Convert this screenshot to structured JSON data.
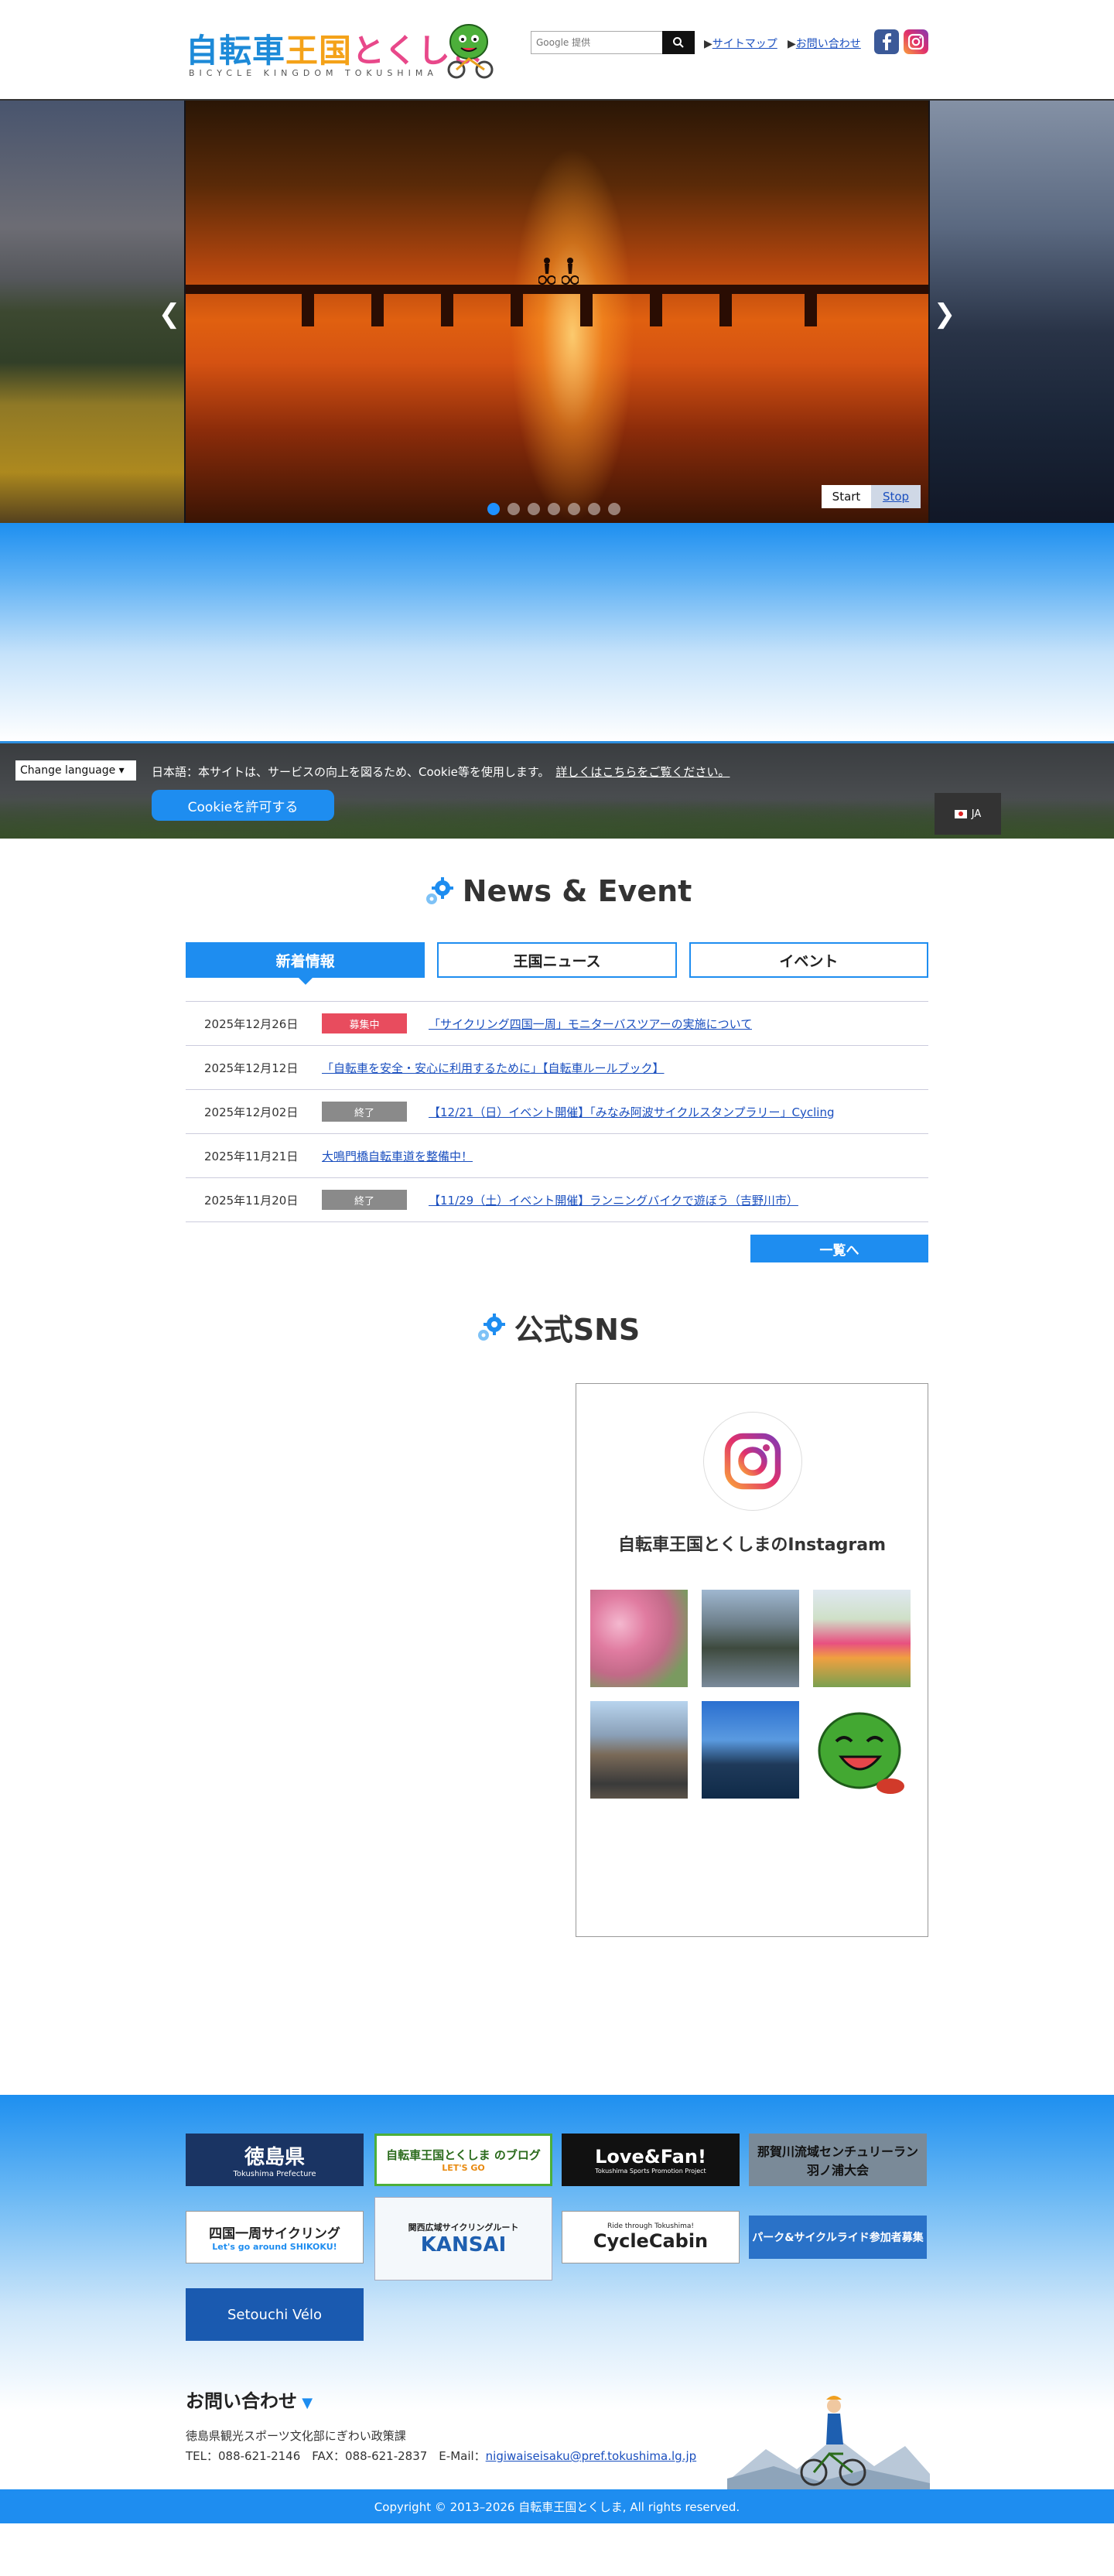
{
  "header": {
    "logo_title_1": "自転車",
    "logo_title_2": "王国",
    "logo_title_3": "とくしま",
    "logo_sub": "BICYCLE KINGDOM TOKUSHIMA",
    "search_placeholder": "Google 提供",
    "sitemap_label": "サイトマップ",
    "contact_label": "お問い合わせ"
  },
  "slider": {
    "start_label": "Start",
    "stop_label": "Stop",
    "dots": [
      1,
      2,
      3,
      4,
      5,
      6,
      7
    ],
    "active_dot": 1
  },
  "cookie": {
    "language_label": "Change language ▾",
    "message": "日本語：本サイトは、サービスの向上を図るため、Cookie等を使用します。",
    "details_link": "詳しくはこちらをご覧ください。",
    "accept_label": "Cookieを許可する",
    "lang_code": "JA"
  },
  "news": {
    "title": "News & Event",
    "tabs": [
      "新着情報",
      "王国ニュース",
      "イベント"
    ],
    "items": [
      {
        "date": "2025年12月26日",
        "tag": "募集中",
        "tag_color": "red",
        "text": "「サイクリング四国一周」モニターバスツアーの実施について"
      },
      {
        "date": "2025年12月12日",
        "tag": "",
        "tag_color": "none",
        "text": "「自転車を安全・安心に利用するために」【自転車ルールブック】"
      },
      {
        "date": "2025年12月02日",
        "tag": "終了",
        "tag_color": "gray",
        "text": "【12/21（日）イベント開催】「みなみ阿波サイクルスタンプラリー」Cycling"
      },
      {
        "date": "2025年11月21日",
        "tag": "",
        "tag_color": "none",
        "text": "大鳴門橋自転車道を整備中！"
      },
      {
        "date": "2025年11月20日",
        "tag": "終了",
        "tag_color": "gray",
        "text": "【11/29（土）イベント開催】ランニングバイクで遊ぼう（吉野川市）"
      }
    ],
    "more_label": "一覧へ"
  },
  "sns": {
    "title": "公式SNS",
    "instagram_name": "自転車王国とくしまのInstagram"
  },
  "footer": {
    "banners": [
      {
        "label": "徳島県",
        "sub": "Tokushima Prefecture"
      },
      {
        "label": "自転車王国とくしま のブログ",
        "sub": "LET'S GO"
      },
      {
        "label": "Love&Fan!",
        "sub": "Tokushima Sports Promotion Project"
      },
      {
        "label": "那賀川流域センチュリーラン",
        "sub": "羽ノ浦大会"
      },
      {
        "label": "四国一周サイクリング",
        "sub": "Let's go around SHIKOKU!"
      },
      {
        "label": "KANSAI",
        "sub": "関西広域サイクリングルート"
      },
      {
        "label": "CycleCabin",
        "sub": "Ride through Tokushima!"
      },
      {
        "label": "パーク&サイクルライド参加者募集",
        "sub": ""
      },
      {
        "label": "Setouchi Vélo",
        "sub": ""
      }
    ],
    "contact_title": "お問い合わせ",
    "department": "徳島県観光スポーツ文化部にぎわい政策課",
    "tel_fax": "TEL：088-621-2146　FAX：088-621-2837　E-Mail：",
    "email": "nigiwaiseisaku@pref.tokushima.lg.jp",
    "copyright": "Copyright © 2013–2026 自転車王国とくしま, All rights reserved."
  },
  "colors": {
    "accent": "#1e8df0",
    "tag_red": "#e84c5e",
    "tag_gray": "#8a8a8a"
  }
}
